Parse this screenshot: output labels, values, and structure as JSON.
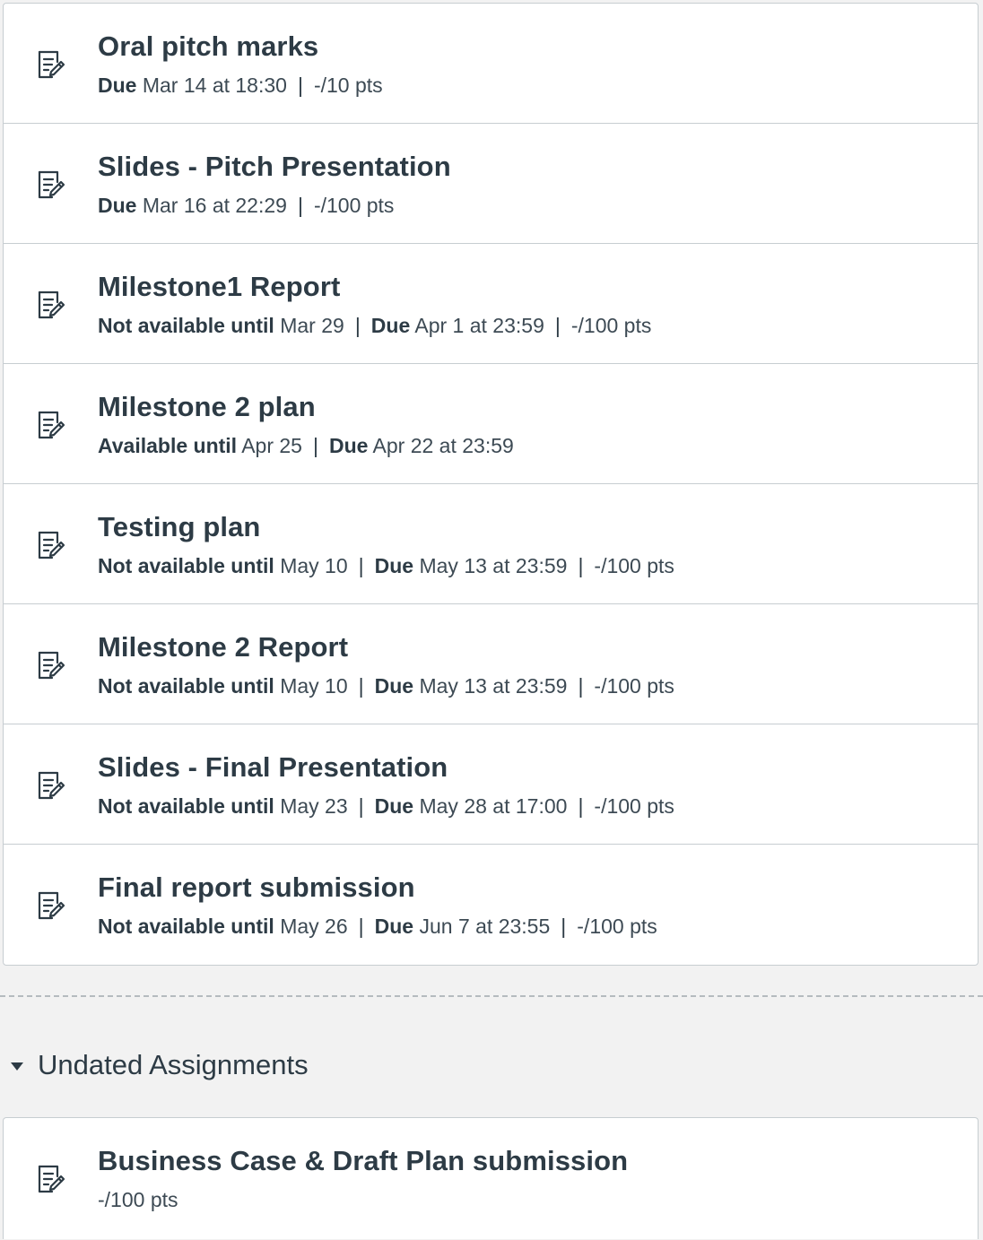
{
  "assignments": [
    {
      "title": "Oral pitch marks",
      "meta": [
        {
          "label": "Due",
          "value": "Mar 14 at 18:30"
        },
        {
          "label": "",
          "value": "-/10 pts"
        }
      ]
    },
    {
      "title": "Slides - Pitch Presentation",
      "meta": [
        {
          "label": "Due",
          "value": "Mar 16 at 22:29"
        },
        {
          "label": "",
          "value": "-/100 pts"
        }
      ]
    },
    {
      "title": "Milestone1 Report",
      "meta": [
        {
          "label": "Not available until",
          "value": "Mar 29"
        },
        {
          "label": "Due",
          "value": "Apr 1 at 23:59"
        },
        {
          "label": "",
          "value": "-/100 pts"
        }
      ]
    },
    {
      "title": "Milestone 2 plan",
      "meta": [
        {
          "label": "Available until",
          "value": "Apr 25"
        },
        {
          "label": "Due",
          "value": "Apr 22 at 23:59"
        }
      ]
    },
    {
      "title": "Testing plan",
      "meta": [
        {
          "label": "Not available until",
          "value": "May 10"
        },
        {
          "label": "Due",
          "value": "May 13 at 23:59"
        },
        {
          "label": "",
          "value": "-/100 pts"
        }
      ]
    },
    {
      "title": "Milestone 2 Report",
      "meta": [
        {
          "label": "Not available until",
          "value": "May 10"
        },
        {
          "label": "Due",
          "value": "May 13 at 23:59"
        },
        {
          "label": "",
          "value": "-/100 pts"
        }
      ]
    },
    {
      "title": "Slides - Final Presentation",
      "meta": [
        {
          "label": "Not available until",
          "value": "May 23"
        },
        {
          "label": "Due",
          "value": "May 28 at 17:00"
        },
        {
          "label": "",
          "value": "-/100 pts"
        }
      ]
    },
    {
      "title": "Final report submission",
      "meta": [
        {
          "label": "Not available until",
          "value": "May 26"
        },
        {
          "label": "Due",
          "value": "Jun 7 at 23:55"
        },
        {
          "label": "",
          "value": "-/100 pts"
        }
      ]
    }
  ],
  "undated": {
    "group_title": "Undated Assignments",
    "items": [
      {
        "title": "Business Case & Draft Plan submission",
        "meta": [
          {
            "label": "",
            "value": "-/100 pts"
          }
        ]
      }
    ]
  },
  "icon_name": "assignment-icon",
  "colors": {
    "text": "#2d3b45",
    "border": "#c7cdd1",
    "background": "#f2f2f2"
  }
}
